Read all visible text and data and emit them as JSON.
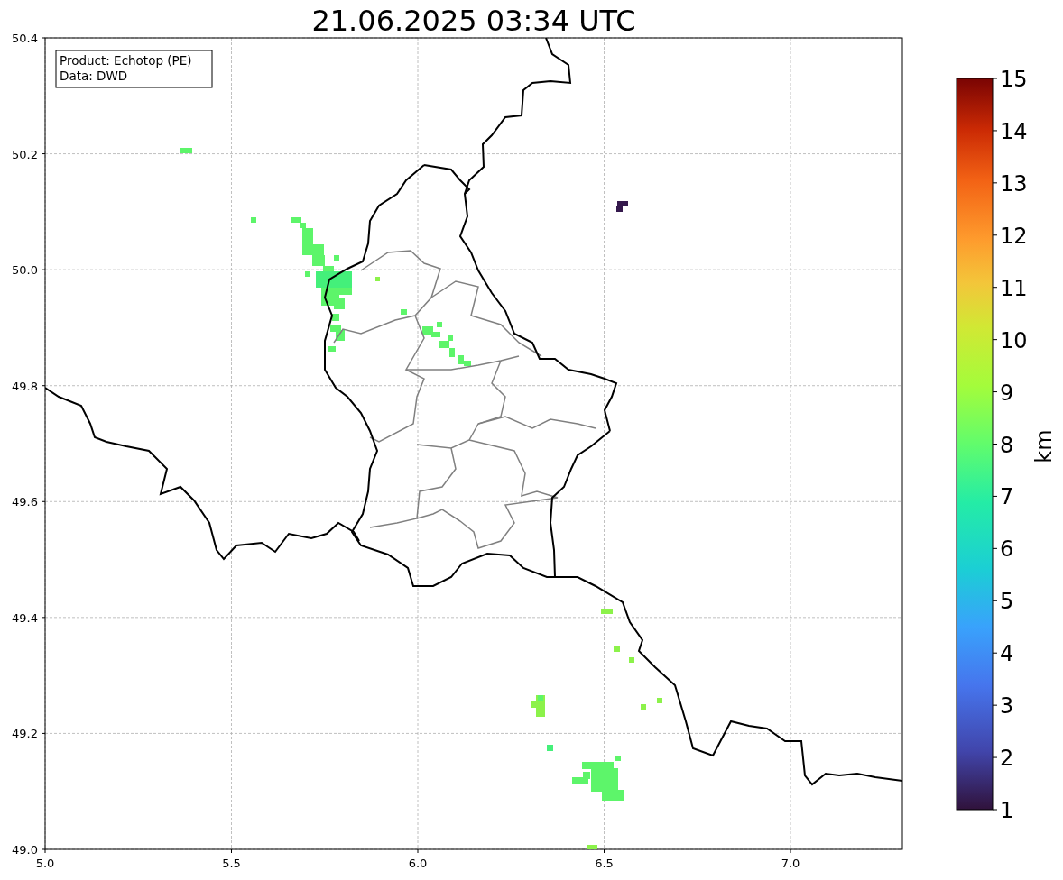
{
  "title": "21.06.2025 03:34 UTC",
  "info_box": {
    "lines": [
      "Product: Echotop (PE)",
      "Data: DWD"
    ]
  },
  "x_ticks": [
    "5.0",
    "5.5",
    "6.0",
    "6.5",
    "7.0"
  ],
  "y_ticks": [
    "50.4",
    "50.2",
    "50.0",
    "49.8",
    "49.6",
    "49.4",
    "49.2",
    "49.0"
  ],
  "colorbar": {
    "label": "km",
    "ticks": [
      "15",
      "14",
      "13",
      "12",
      "11",
      "10",
      "9",
      "8",
      "7",
      "6",
      "5",
      "4",
      "3",
      "2",
      "1"
    ]
  }
}
